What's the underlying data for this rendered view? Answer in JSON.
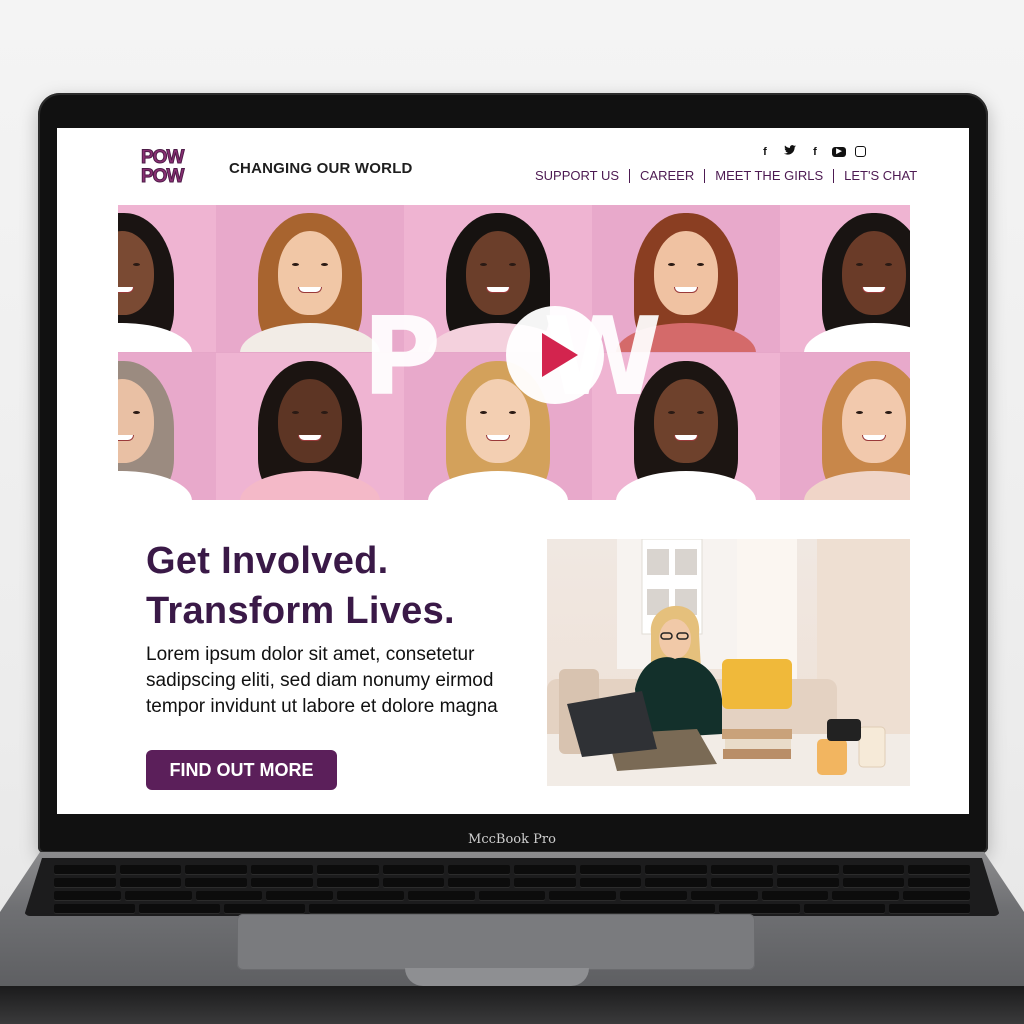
{
  "device": {
    "model_label": "MccBook Pro"
  },
  "site": {
    "logo": {
      "line1": "POW",
      "line2": "POW"
    },
    "tagline": "CHANGING OUR WORLD",
    "social": [
      {
        "icon": "facebook-icon",
        "glyph": "f"
      },
      {
        "icon": "twitter-icon",
        "glyph": "t"
      },
      {
        "icon": "facebook-icon",
        "glyph": "f"
      },
      {
        "icon": "youtube-icon",
        "glyph": "▶"
      },
      {
        "icon": "instagram-icon",
        "glyph": "◎"
      }
    ],
    "nav": [
      "SUPPORT US",
      "CAREER",
      "MEET THE GIRLS",
      "LET'S CHAT"
    ],
    "hero": {
      "word_left": "P",
      "word_right": "W"
    },
    "headline": {
      "line1": "Get Involved.",
      "line2": "Transform Lives."
    },
    "body": "Lorem ipsum dolor sit amet, consetetur sadipscing eliti, sed diam nonumy eirmod tempor invidunt ut labore et dolore magna",
    "cta": "FIND OUT MORE"
  },
  "colors": {
    "brand_purple": "#5b1f5a",
    "nav_text": "#4d1a52",
    "hero_pink": "#e6a7c9",
    "play_red": "#d3244e"
  }
}
